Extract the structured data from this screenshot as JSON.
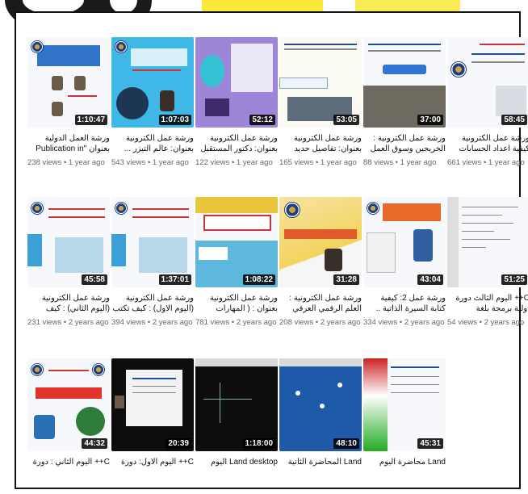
{
  "videos": [
    {
      "title": "ورشة العمل الدولية بعنوان \"Publication in the...",
      "meta": "238 views • 1 year ago",
      "duration": "1:10:47"
    },
    {
      "title": "ورشة عمل الكترونية بعنوان: عالم التيزر ... تكنولوجيا المستقبل أصبحت واقعا",
      "meta": "543 views • 1 year ago",
      "duration": "1:07:03"
    },
    {
      "title": "ورشة عمل الكترونية بعنوان: دكتور المستقبل ... متطلبات سوق العمل على الطاقة ريادة",
      "meta": "122 views • 1 year ago",
      "duration": "52:12"
    },
    {
      "title": "ورشة عمل الكترونية بعنوان: تفاصيل حديد التسليح",
      "meta": "165 views • 1 year ago",
      "duration": "53:05"
    },
    {
      "title": "ورشة عمل الكترونية : الخريجين وسوق العمل",
      "meta": "88 views • 1 year ago",
      "duration": "37:00"
    },
    {
      "title": "ورشة عمل الكترونية كيفية اعداد الحسابات الختامية للقطاع الحكومي العمومي",
      "meta": "661 views • 1 year ago",
      "duration": "58:45"
    },
    {
      "title": "ورشة عمل الكترونية (اليوم الثاني) : كيف تكتب سيرة ذاتية وماهي المهارات اللازمة",
      "meta": "231 views • 2 years ago",
      "duration": "45:58"
    },
    {
      "title": "ورشة عمل الكترونية (اليوم الاول) : كيف تكتب سيرة ذاتية وماهي المهارات اللازمة",
      "meta": "394 views • 2 years ago",
      "duration": "1:37:01"
    },
    {
      "title": "ورشة عمل الكترونية بعنوان : ( المهارات الناعمة ومتطلبات سوق العمل)",
      "meta": "781 views • 2 years ago",
      "duration": "1:08:22"
    },
    {
      "title": "ورشة عمل الكترونية : العلم الرقمي العرقي للتوثيق والتصنيف الاثي",
      "meta": "208 views • 2 years ago",
      "duration": "31:28"
    },
    {
      "title": "ورشة عمل 2: كيفية كتابة السيرة الذاتية .. واجراء مقابلة عمل ناجحة",
      "meta": "334 views • 2 years ago",
      "duration": "43:04"
    },
    {
      "title": "C++ اليوم الثالث دورة اولية برمجة بلغة",
      "meta": "54 views • 2 years ago",
      "duration": "51:25"
    },
    {
      "title": "C++ اليوم الثاني : دورة اولية برمجة",
      "meta": "",
      "duration": "44:32"
    },
    {
      "title": "C++ اليوم الاول: دورة اولية برمجة بلغة",
      "meta": "",
      "duration": "20:39"
    },
    {
      "title": "Land desktop اليوم الثالث دورة",
      "meta": "",
      "duration": "1:18:00"
    },
    {
      "title": "Land المحاضرة الثانية دورة برنامج",
      "meta": "",
      "duration": "48:10"
    },
    {
      "title": "Land محاضرة اليوم الاول دورة برنامج",
      "meta": "",
      "duration": "45:31"
    }
  ]
}
